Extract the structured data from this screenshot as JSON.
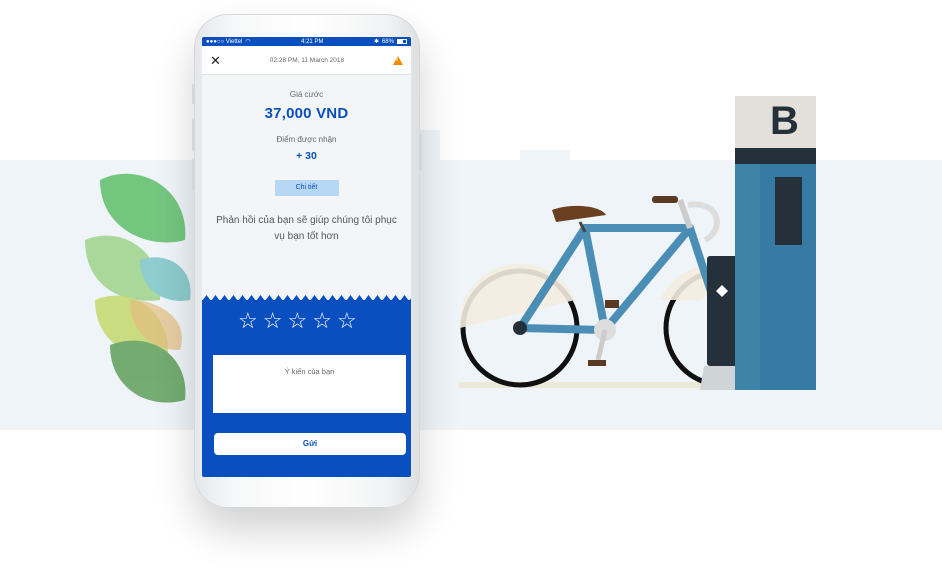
{
  "status_bar": {
    "carrier": "●●●○○ Viettel",
    "time": "4:21 PM",
    "battery": "68%"
  },
  "top_bar": {
    "datetime": "02:28 PM, 11 March 2018",
    "close_icon": "close-icon",
    "warning_icon": "warning-icon"
  },
  "fare": {
    "label": "Giá cước",
    "value": "37,000 VND"
  },
  "points": {
    "label": "Điểm được nhận",
    "value": "+ 30"
  },
  "detail_button": "Chi tiết",
  "feedback_message": "Phản hồi của bạn sẽ giúp chúng tôi phục vụ bạn tốt hơn",
  "rating": {
    "stars": [
      "☆",
      "☆",
      "☆",
      "☆",
      "☆"
    ],
    "selected": 0
  },
  "comment_placeholder": "Ý kiến của bạn",
  "send_button": "Gửi",
  "illustration": {
    "station_letter": "B"
  },
  "colors": {
    "brand_blue": "#0a4fbf",
    "detail_bg": "#b6d8f5",
    "warning": "#f08a00",
    "bike_frame": "#4a8db5",
    "station": "#3f84a8"
  }
}
